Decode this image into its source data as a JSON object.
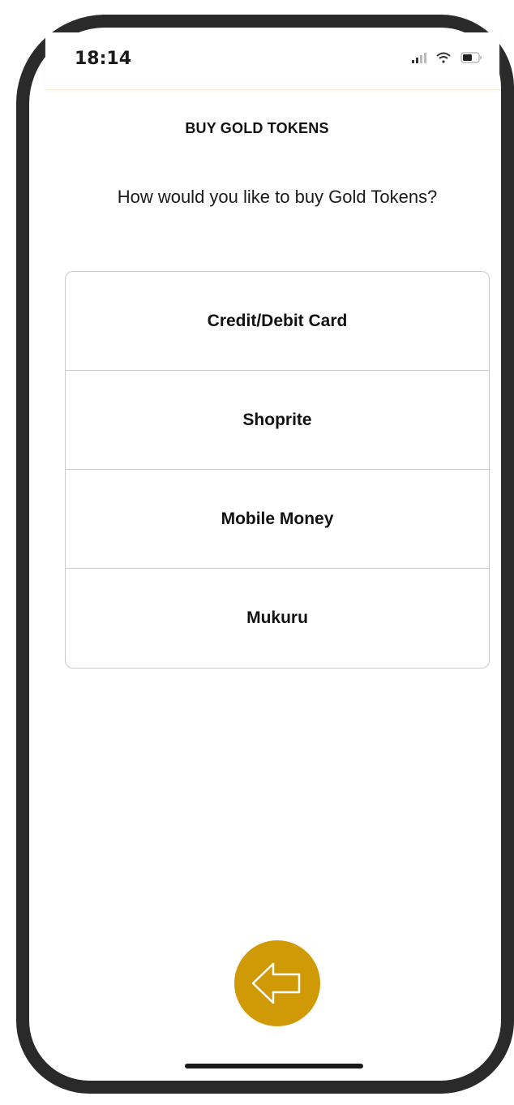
{
  "status_bar": {
    "time": "18:14",
    "icons": [
      "signal-icon",
      "wifi-icon",
      "battery-icon"
    ]
  },
  "header": {
    "title": "BUY GOLD TOKENS"
  },
  "main": {
    "prompt": "How would you like to buy Gold Tokens?",
    "options": [
      {
        "label": "Credit/Debit Card"
      },
      {
        "label": "Shoprite"
      },
      {
        "label": "Mobile Money"
      },
      {
        "label": "Mukuru"
      }
    ]
  },
  "footer": {
    "back_icon": "arrow-left-icon"
  },
  "colors": {
    "accent": "#d09a06",
    "frame": "#2a2a2a",
    "border": "#c9c9c9"
  }
}
